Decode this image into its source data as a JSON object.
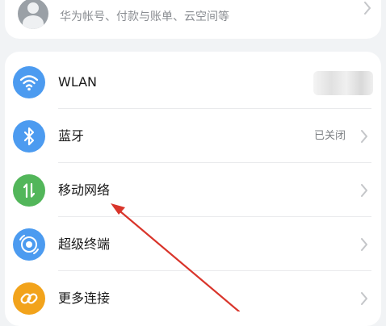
{
  "account": {
    "subtitle": "华为帐号、付款与账单、云空间等"
  },
  "rows": [
    {
      "label": "WLAN",
      "status": "",
      "icon": "wifi-icon",
      "color": "#4c9bf0"
    },
    {
      "label": "蓝牙",
      "status": "已关闭",
      "icon": "bluetooth-icon",
      "color": "#4c9bf0"
    },
    {
      "label": "移动网络",
      "status": "",
      "icon": "mobile-data-icon",
      "color": "#52b65a"
    },
    {
      "label": "超级终端",
      "status": "",
      "icon": "super-device-icon",
      "color": "#4c9bf0"
    },
    {
      "label": "更多连接",
      "status": "",
      "icon": "link-icon",
      "color": "#f2a31b"
    }
  ],
  "annotation": {
    "color": "#d9352b"
  }
}
